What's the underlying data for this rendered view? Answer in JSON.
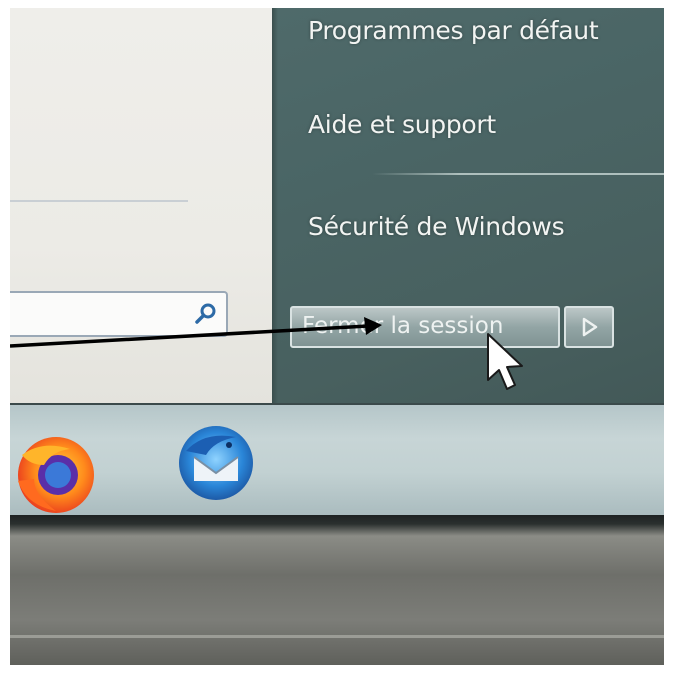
{
  "start_menu": {
    "right_pane": {
      "items": [
        {
          "label": "Programmes par défaut"
        },
        {
          "label": "Aide et support"
        },
        {
          "label": "Sécurité de Windows"
        }
      ],
      "shutdown_button": {
        "label": "Fermer la session"
      }
    },
    "search": {
      "value": ""
    }
  },
  "taskbar": {
    "apps": [
      {
        "icon": "firefox-icon"
      },
      {
        "icon": "thunderbird-icon"
      }
    ]
  },
  "colors": {
    "pane": "#4a6565",
    "button": "#93a5a5",
    "annotation": "#000000"
  }
}
